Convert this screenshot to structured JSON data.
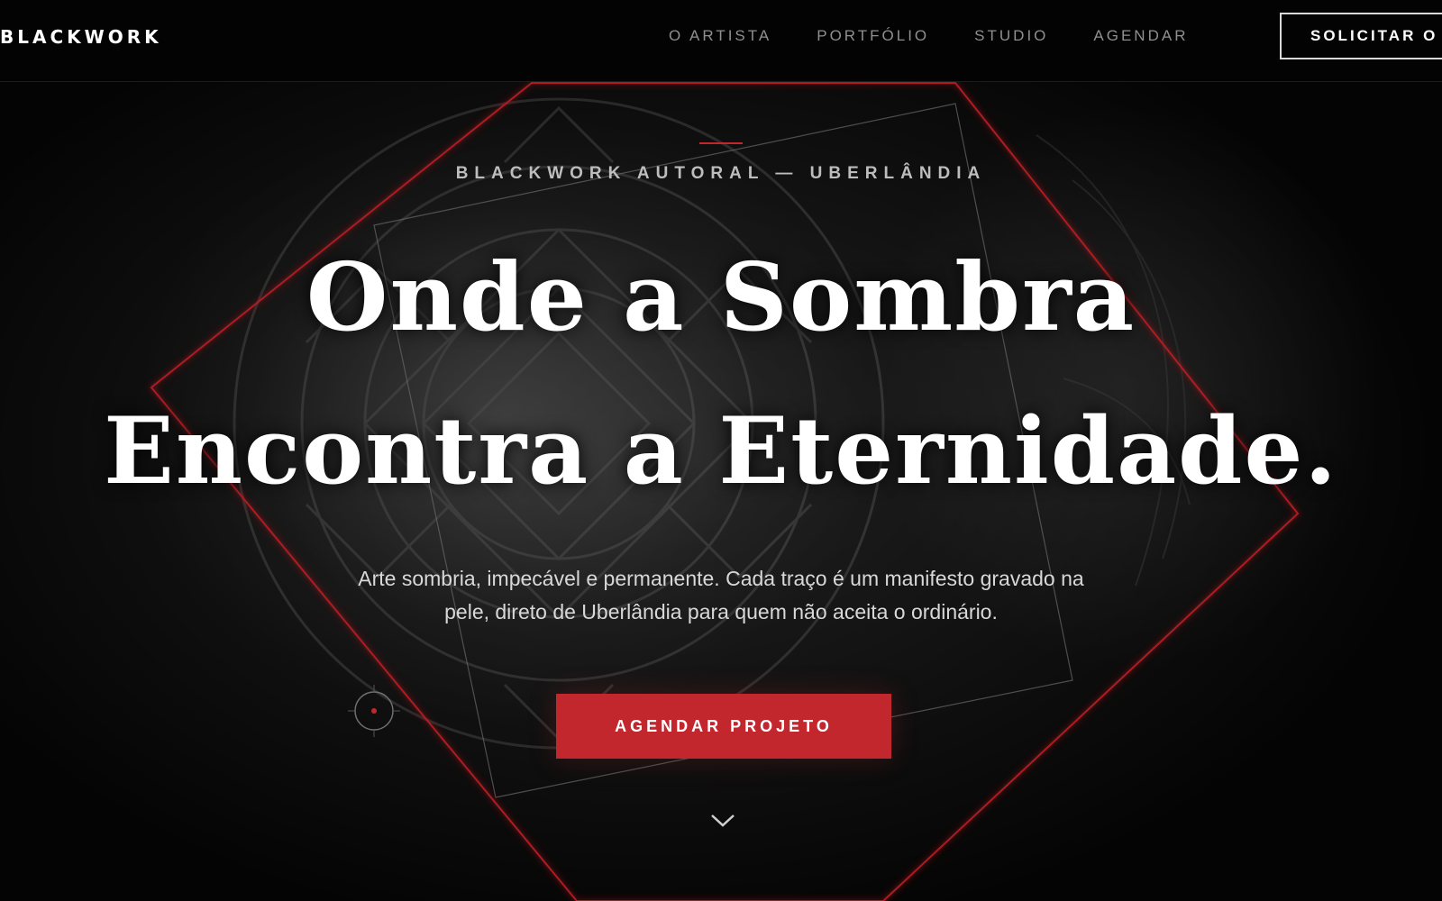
{
  "header": {
    "logo": "BLACKWORK",
    "nav": [
      "O ARTISTA",
      "PORTFÓLIO",
      "STUDIO",
      "AGENDAR"
    ],
    "cta_label": "SOLICITAR O"
  },
  "hero": {
    "eyebrow": "BLACKWORK AUTORAL — UBERLÂNDIA",
    "headline_line1": "Onde a Sombra",
    "headline_line2": "Encontra a Eternidade.",
    "subtext_line1": "Arte sombria, impecável e permanente. Cada traço é um manifesto gravado na",
    "subtext_line2": "pele, direto de Uberlândia para quem não aceita o ordinário.",
    "button_label": "AGENDAR PROJETO"
  },
  "colors": {
    "accent": "#c1272d",
    "background": "#040404",
    "text": "#ffffff",
    "nav_text": "#8f8f8f"
  },
  "icons": {
    "scroll": "chevron-down-icon",
    "target": "target-icon"
  }
}
